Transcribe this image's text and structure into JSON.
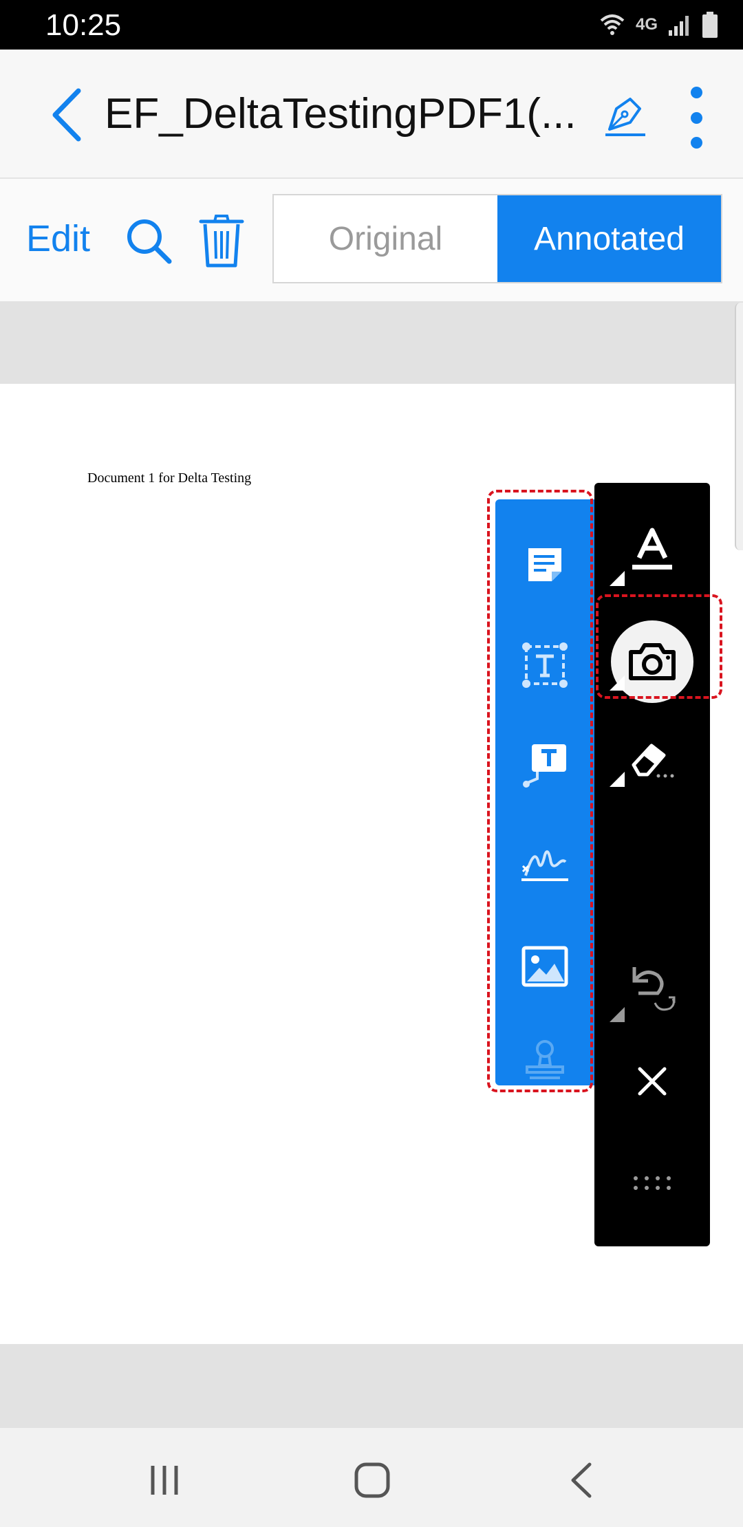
{
  "status_bar": {
    "time": "10:25",
    "network_label": "4G"
  },
  "app_bar": {
    "title": "EF_DeltaTestingPDF1(...",
    "back_icon": "chevron-left-icon",
    "sign_icon": "fountain-pen-icon",
    "more_icon": "more-vertical-icon"
  },
  "toolbar": {
    "edit_label": "Edit",
    "search_icon": "search-icon",
    "delete_icon": "trash-icon",
    "segments": [
      {
        "label": "Original",
        "selected": false
      },
      {
        "label": "Annotated",
        "selected": true
      }
    ]
  },
  "document": {
    "text": "Document 1 for Delta Testing"
  },
  "annotation_tools": [
    {
      "icon": "sticky-note-icon"
    },
    {
      "icon": "text-box-icon"
    },
    {
      "icon": "callout-icon"
    },
    {
      "icon": "signature-icon"
    },
    {
      "icon": "image-icon"
    },
    {
      "icon": "stamp-icon"
    }
  ],
  "quick_tools": [
    {
      "icon": "text-style-icon"
    },
    {
      "icon": "camera-icon",
      "selected": true
    },
    {
      "icon": "eraser-icon"
    },
    {
      "icon": "undo-redo-icon"
    },
    {
      "icon": "close-icon"
    },
    {
      "icon": "drag-handle-icon"
    }
  ],
  "colors": {
    "accent": "#1282ee",
    "highlight_dash": "#d9141f",
    "panel_dark": "#000000"
  },
  "nav_bar": {
    "items": [
      "recent-apps-icon",
      "home-icon",
      "back-icon"
    ]
  }
}
